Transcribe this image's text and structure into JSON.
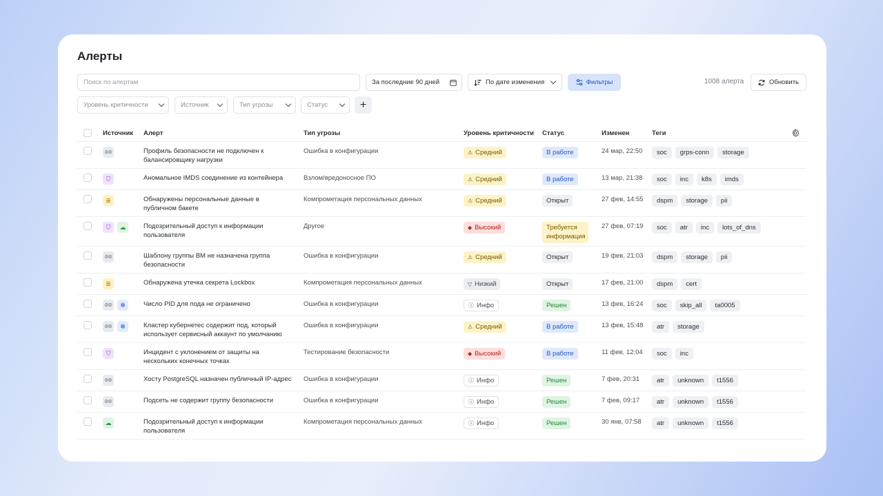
{
  "page": {
    "title": "Алерты"
  },
  "toolbar": {
    "search_placeholder": "Поиск по алертам",
    "date_range": "За последние 90 дней",
    "sort": "По дате изменения",
    "filters": "Фильтры",
    "count": "1008 алерта",
    "refresh": "Обновить"
  },
  "filters": {
    "severity": "Уровень критичности",
    "source": "Источник",
    "threat": "Тип угрозы",
    "status": "Статус",
    "add": "+"
  },
  "table": {
    "headers": {
      "source": "Источник",
      "alert": "Алерт",
      "threat": "Тип угрозы",
      "severity": "Уровень критичности",
      "status": "Статус",
      "changed": "Изменен",
      "tags": "Теги"
    },
    "rows": [
      {
        "sources": [
          "binoculars-icon"
        ],
        "alert": "Профиль безопасности не подключен к балансировщику нагрузки",
        "threat": "Ошибка в конфигурации",
        "severity": "Средний",
        "sev_type": "med",
        "status": "В работе",
        "st_type": "work",
        "changed": "24 мар, 22:50",
        "tags": [
          "soc",
          "grps-conn",
          "storage"
        ]
      },
      {
        "sources": [
          "shield-icon"
        ],
        "alert": "Аномальное IMDS соединение из контейнера",
        "threat": "Взлом/вредоносное ПО",
        "severity": "Средний",
        "sev_type": "med",
        "status": "В работе",
        "st_type": "work",
        "changed": "13 мар, 21:38",
        "tags": [
          "soc",
          "inc",
          "k8s",
          "imds"
        ]
      },
      {
        "sources": [
          "database-icon"
        ],
        "alert": "Обнаружены персональные данные в публичном бакете",
        "threat": "Компрометация персональных данных",
        "severity": "Средний",
        "sev_type": "med",
        "status": "Открыт",
        "st_type": "open",
        "changed": "27 фев, 14:55",
        "tags": [
          "dspm",
          "storage",
          "pii"
        ]
      },
      {
        "sources": [
          "shield-icon",
          "cloud-icon"
        ],
        "alert": "Подозрительный доступ к информации пользователя",
        "threat": "Другое",
        "severity": "Высокий",
        "sev_type": "high",
        "status": "Требуется информация",
        "st_type": "need",
        "changed": "27 фев, 07:19",
        "tags": [
          "soc",
          "atr",
          "inc",
          "lots_of_dns"
        ]
      },
      {
        "sources": [
          "binoculars-icon"
        ],
        "alert": "Шаблону группы ВМ не назначена группа безопасности",
        "threat": "Ошибка в конфигурации",
        "severity": "Средний",
        "sev_type": "med",
        "status": "Открыт",
        "st_type": "open",
        "changed": "19 фев, 21:03",
        "tags": [
          "dspm",
          "storage",
          "pii"
        ]
      },
      {
        "sources": [
          "database-icon"
        ],
        "alert": "Обнаружена утечка секрета Lockbox",
        "threat": "Компрометация персональных данных",
        "severity": "Низкий",
        "sev_type": "low",
        "status": "Открыт",
        "st_type": "open",
        "changed": "17 фев, 21:00",
        "tags": [
          "dspm",
          "cert"
        ]
      },
      {
        "sources": [
          "binoculars-icon",
          "kubernetes-icon"
        ],
        "alert": "Число PID для пода не ограничено",
        "threat": "Ошибка в конфигурации",
        "severity": "Инфо",
        "sev_type": "info",
        "status": "Решен",
        "st_type": "done",
        "changed": "13 фев, 16:24",
        "tags": [
          "soc",
          "skip_all",
          "ta0005"
        ]
      },
      {
        "sources": [
          "binoculars-icon",
          "kubernetes-icon"
        ],
        "alert": "Кластер кубернетес содержит под, который использует сервисный аккаунт по умолчанию",
        "threat": "Ошибка в конфигурации",
        "severity": "Средний",
        "sev_type": "med",
        "status": "В работе",
        "st_type": "work",
        "changed": "13 фев, 15:48",
        "tags": [
          "atr",
          "storage"
        ]
      },
      {
        "sources": [
          "shield-icon"
        ],
        "alert": "Инцидент с уклонением от защиты на нескольких конечных точках",
        "threat": "Тестирование безопасности",
        "severity": "Высокий",
        "sev_type": "high",
        "status": "В работе",
        "st_type": "work",
        "changed": "11 фев, 12:04",
        "tags": [
          "soc",
          "inc"
        ]
      },
      {
        "sources": [
          "binoculars-icon"
        ],
        "alert": "Хосту PostgreSQL назначен публичный IP-адрес",
        "threat": "Ошибка в конфигурации",
        "severity": "Инфо",
        "sev_type": "info",
        "status": "Решен",
        "st_type": "done",
        "changed": "7 фев, 20:31",
        "tags": [
          "atr",
          "unknown",
          "t1556"
        ]
      },
      {
        "sources": [
          "binoculars-icon"
        ],
        "alert": "Подсеть не содержит группу безопасности",
        "threat": "Ошибка в конфигурации",
        "severity": "Инфо",
        "sev_type": "info",
        "status": "Решен",
        "st_type": "done",
        "changed": "7 фев, 09:17",
        "tags": [
          "atr",
          "unknown",
          "t1556"
        ]
      },
      {
        "sources": [
          "cloud-icon"
        ],
        "alert": "Подозрительный доступ к информации пользователя",
        "threat": "Компрометация персональных данных",
        "severity": "Инфо",
        "sev_type": "info",
        "status": "Решен",
        "st_type": "done",
        "changed": "30 янв, 07:58",
        "tags": [
          "atr",
          "unknown",
          "t1556"
        ]
      }
    ]
  }
}
